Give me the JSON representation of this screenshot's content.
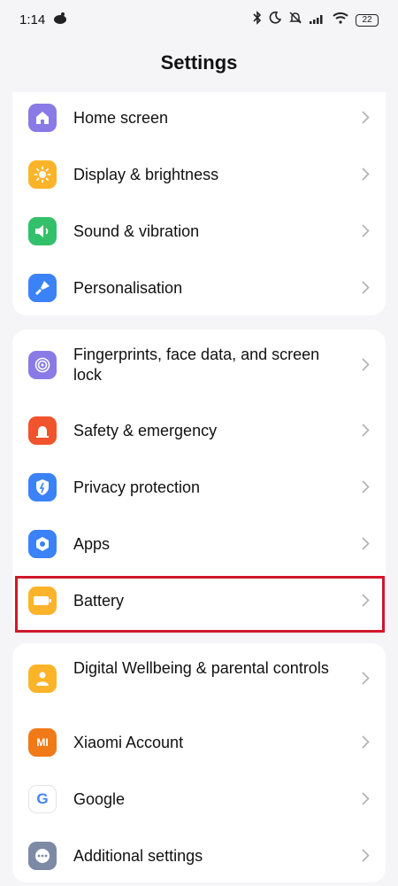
{
  "status_bar": {
    "time": "1:14",
    "battery": "22"
  },
  "header": {
    "title": "Settings"
  },
  "groups": [
    {
      "items": [
        {
          "label": "Home screen",
          "icon": "home-icon",
          "color": "#8a7ae6"
        },
        {
          "label": "Display & brightness",
          "icon": "sun-icon",
          "color": "#fbb42a"
        },
        {
          "label": "Sound & vibration",
          "icon": "speaker-icon",
          "color": "#33c06a"
        },
        {
          "label": "Personalisation",
          "icon": "brush-icon",
          "color": "#3b82f6"
        }
      ]
    },
    {
      "items": [
        {
          "label": "Fingerprints, face data, and screen lock",
          "icon": "fingerprint-icon",
          "color": "#8a7ae6"
        },
        {
          "label": "Safety & emergency",
          "icon": "siren-icon",
          "color": "#f0542c"
        },
        {
          "label": "Privacy protection",
          "icon": "shield-icon",
          "color": "#3b82f6"
        },
        {
          "label": "Apps",
          "icon": "apps-gear-icon",
          "color": "#3b82f6"
        },
        {
          "label": "Battery",
          "icon": "battery-icon",
          "color": "#fbb42a"
        }
      ]
    },
    {
      "items": [
        {
          "label": "Digital Wellbeing & parental controls",
          "icon": "person-icon",
          "color": "#fbb42a"
        },
        {
          "label": "Xiaomi Account",
          "icon": "mi-logo-icon",
          "color": "#f07a18",
          "text": "MI"
        },
        {
          "label": "Google",
          "icon": "google-g-icon",
          "color": "#ffffff",
          "text": "G"
        },
        {
          "label": "Additional settings",
          "icon": "more-dots-icon",
          "color": "#7d8aa6"
        }
      ]
    }
  ],
  "highlight_color": "#d0172a"
}
